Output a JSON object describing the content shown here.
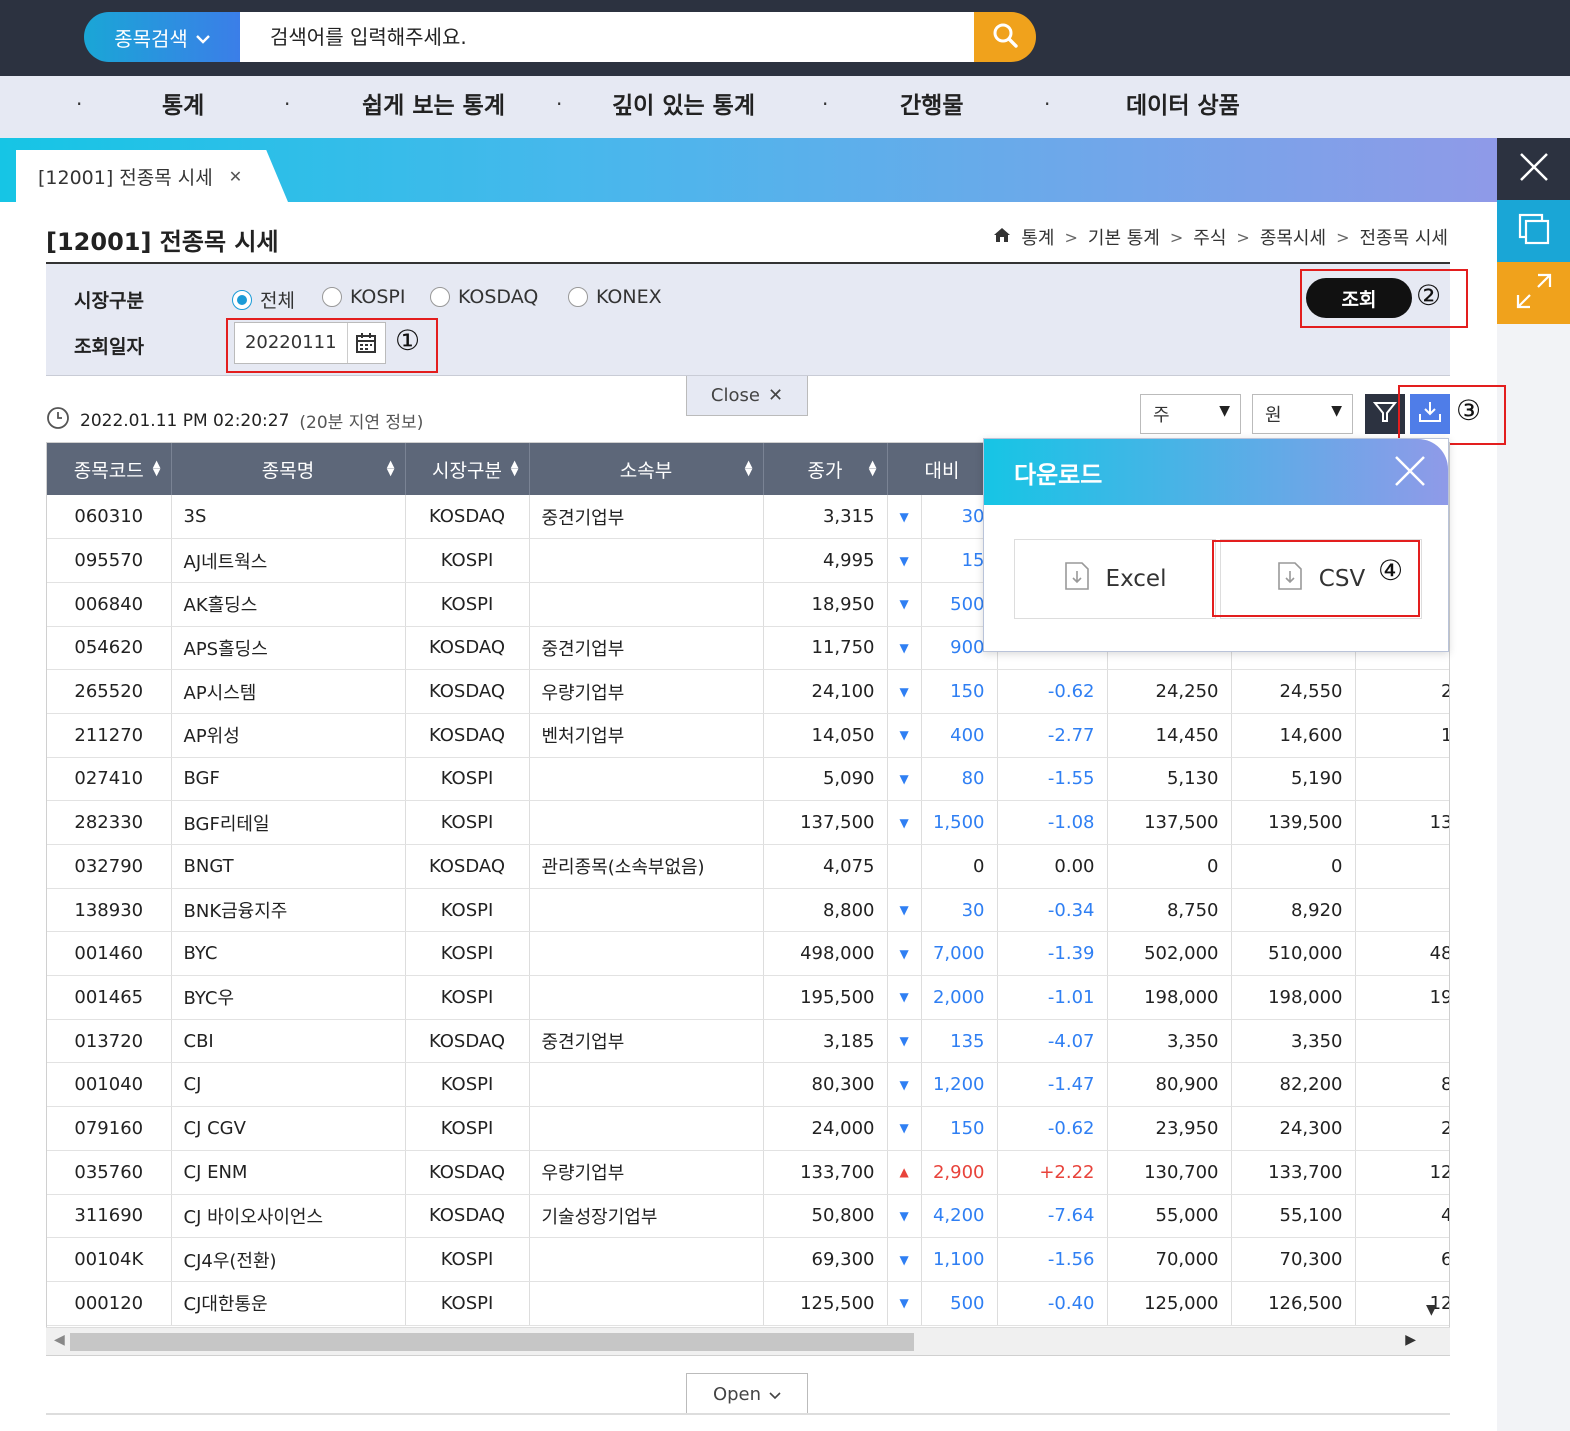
{
  "search": {
    "category": "종목검색",
    "placeholder": "검색어를 입력해주세요."
  },
  "nav": {
    "items": [
      "통계",
      "쉽게 보는 통계",
      "깊이 있는 통계",
      "간행물",
      "데이터 상품"
    ]
  },
  "tab": {
    "label": "[12001] 전종목 시세"
  },
  "page": {
    "title": "[12001] 전종목 시세",
    "breadcrumb": [
      "통계",
      "기본 통계",
      "주식",
      "종목시세",
      "전종목 시세"
    ]
  },
  "filter": {
    "market_label": "시장구분",
    "date_label": "조회일자",
    "markets": [
      "전체",
      "KOSPI",
      "KOSDAQ",
      "KONEX"
    ],
    "selected_market": "전체",
    "date_value": "20220111",
    "query_label": "조회",
    "close_label": "Close"
  },
  "annotations": [
    "①",
    "②",
    "③",
    "④"
  ],
  "timestamp": {
    "time": "2022.01.11 PM 02:20:27",
    "note": "(20분 지연 정보)"
  },
  "units": {
    "share": "주",
    "currency": "원"
  },
  "table": {
    "headers": [
      "종목코드",
      "종목명",
      "시장구분",
      "소속부",
      "종가",
      "대비",
      "",
      "",
      "",
      ""
    ],
    "rows": [
      [
        "060310",
        "3S",
        "KOSDAQ",
        "중견기업부",
        "3,315",
        "down",
        "30",
        "",
        "",
        "",
        ""
      ],
      [
        "095570",
        "AJ네트웍스",
        "KOSPI",
        "",
        "4,995",
        "down",
        "15",
        "",
        "",
        "",
        ""
      ],
      [
        "006840",
        "AK홀딩스",
        "KOSPI",
        "",
        "18,950",
        "down",
        "500",
        "",
        "",
        "",
        ""
      ],
      [
        "054620",
        "APS홀딩스",
        "KOSDAQ",
        "중견기업부",
        "11,750",
        "down",
        "900",
        "",
        "",
        "",
        ""
      ],
      [
        "265520",
        "AP시스템",
        "KOSDAQ",
        "우량기업부",
        "24,100",
        "down",
        "150",
        "-0.62",
        "24,250",
        "24,550",
        "2"
      ],
      [
        "211270",
        "AP위성",
        "KOSDAQ",
        "벤처기업부",
        "14,050",
        "down",
        "400",
        "-2.77",
        "14,450",
        "14,600",
        "1"
      ],
      [
        "027410",
        "BGF",
        "KOSPI",
        "",
        "5,090",
        "down",
        "80",
        "-1.55",
        "5,130",
        "5,190",
        ""
      ],
      [
        "282330",
        "BGF리테일",
        "KOSPI",
        "",
        "137,500",
        "down",
        "1,500",
        "-1.08",
        "137,500",
        "139,500",
        "13"
      ],
      [
        "032790",
        "BNGT",
        "KOSDAQ",
        "관리종목(소속부없음)",
        "4,075",
        "",
        "0",
        "0.00",
        "0",
        "0",
        ""
      ],
      [
        "138930",
        "BNK금융지주",
        "KOSPI",
        "",
        "8,800",
        "down",
        "30",
        "-0.34",
        "8,750",
        "8,920",
        ""
      ],
      [
        "001460",
        "BYC",
        "KOSPI",
        "",
        "498,000",
        "down",
        "7,000",
        "-1.39",
        "502,000",
        "510,000",
        "48"
      ],
      [
        "001465",
        "BYC우",
        "KOSPI",
        "",
        "195,500",
        "down",
        "2,000",
        "-1.01",
        "198,000",
        "198,000",
        "19"
      ],
      [
        "013720",
        "CBI",
        "KOSDAQ",
        "중견기업부",
        "3,185",
        "down",
        "135",
        "-4.07",
        "3,350",
        "3,350",
        ""
      ],
      [
        "001040",
        "CJ",
        "KOSPI",
        "",
        "80,300",
        "down",
        "1,200",
        "-1.47",
        "80,900",
        "82,200",
        "8"
      ],
      [
        "079160",
        "CJ CGV",
        "KOSPI",
        "",
        "24,000",
        "down",
        "150",
        "-0.62",
        "23,950",
        "24,300",
        "2"
      ],
      [
        "035760",
        "CJ ENM",
        "KOSDAQ",
        "우량기업부",
        "133,700",
        "up",
        "2,900",
        "+2.22",
        "130,700",
        "133,700",
        "12"
      ],
      [
        "311690",
        "CJ 바이오사이언스",
        "KOSDAQ",
        "기술성장기업부",
        "50,800",
        "down",
        "4,200",
        "-7.64",
        "55,000",
        "55,100",
        "4"
      ],
      [
        "00104K",
        "CJ4우(전환)",
        "KOSPI",
        "",
        "69,300",
        "down",
        "1,100",
        "-1.56",
        "70,000",
        "70,300",
        "6"
      ],
      [
        "000120",
        "CJ대한통운",
        "KOSPI",
        "",
        "125,500",
        "down",
        "500",
        "-0.40",
        "125,000",
        "126,500",
        "12"
      ]
    ]
  },
  "download": {
    "title": "다운로드",
    "excel": "Excel",
    "csv": "CSV"
  },
  "open_label": "Open",
  "colors": {
    "accent": "#1a9bd7",
    "down": "#2f7ff3",
    "up": "#e8433b",
    "header": "#5d6779",
    "search_btn": "#f0a21c"
  }
}
